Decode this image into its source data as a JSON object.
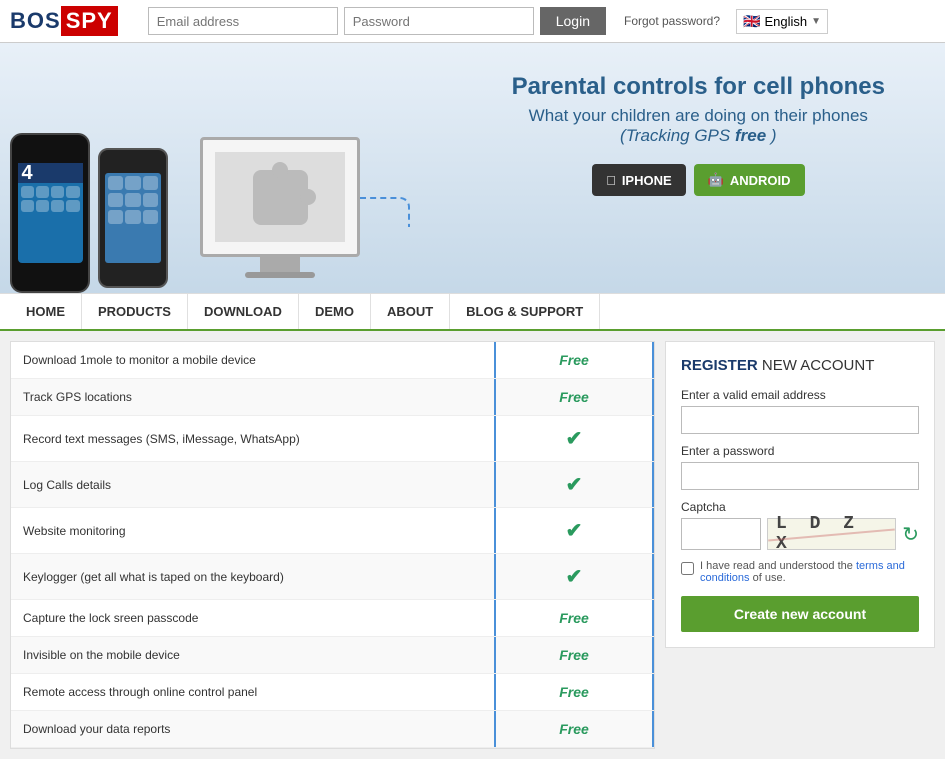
{
  "header": {
    "logo_bos": "BOS",
    "logo_spy": "SPY",
    "email_placeholder": "Email address",
    "password_placeholder": "Password",
    "login_label": "Login",
    "forgot_label": "Forgot password?",
    "lang_label": "English"
  },
  "hero": {
    "headline": "Parental controls for cell phones",
    "subheadline": "What your children are doing on their phones",
    "subheadline2_prefix": "(",
    "tracking_label": "Tracking GPS ",
    "free_label": "free",
    "subheadline2_suffix": ")",
    "iphone_btn": "IPHONE",
    "android_btn": "ANDROID"
  },
  "nav": {
    "items": [
      {
        "label": "HOME"
      },
      {
        "label": "PRODUCTS"
      },
      {
        "label": "DOWNLOAD"
      },
      {
        "label": "DEMO"
      },
      {
        "label": "ABOUT"
      },
      {
        "label": "BLOG & SUPPORT"
      }
    ]
  },
  "features": {
    "rows": [
      {
        "name": "Download 1mole to monitor a mobile device",
        "value": "Free",
        "type": "free"
      },
      {
        "name": "Track GPS locations",
        "value": "Free",
        "type": "free"
      },
      {
        "name": "Record text messages (SMS, iMessage, WhatsApp)",
        "value": "✔",
        "type": "check"
      },
      {
        "name": "Log Calls details",
        "value": "✔",
        "type": "check"
      },
      {
        "name": "Website monitoring",
        "value": "✔",
        "type": "check"
      },
      {
        "name": "Keylogger (get all what is taped on the keyboard)",
        "value": "✔",
        "type": "check"
      },
      {
        "name": "Capture the lock sreen passcode",
        "value": "Free",
        "type": "free"
      },
      {
        "name": "Invisible on the mobile device",
        "value": "Free",
        "type": "free"
      },
      {
        "name": "Remote access through online control panel",
        "value": "Free",
        "type": "free"
      },
      {
        "name": "Download your data reports",
        "value": "Free",
        "type": "free"
      }
    ]
  },
  "register": {
    "title": "REGISTER",
    "title_suffix": " NEW ACCOUNT",
    "email_label": "Enter a valid email address",
    "password_label": "Enter a password",
    "captcha_label": "Captcha",
    "captcha_text": "L D Z X",
    "terms_text": "I have read and understood the ",
    "terms_link": "terms and conditions",
    "terms_suffix": " of use.",
    "create_btn": "Create new account"
  }
}
